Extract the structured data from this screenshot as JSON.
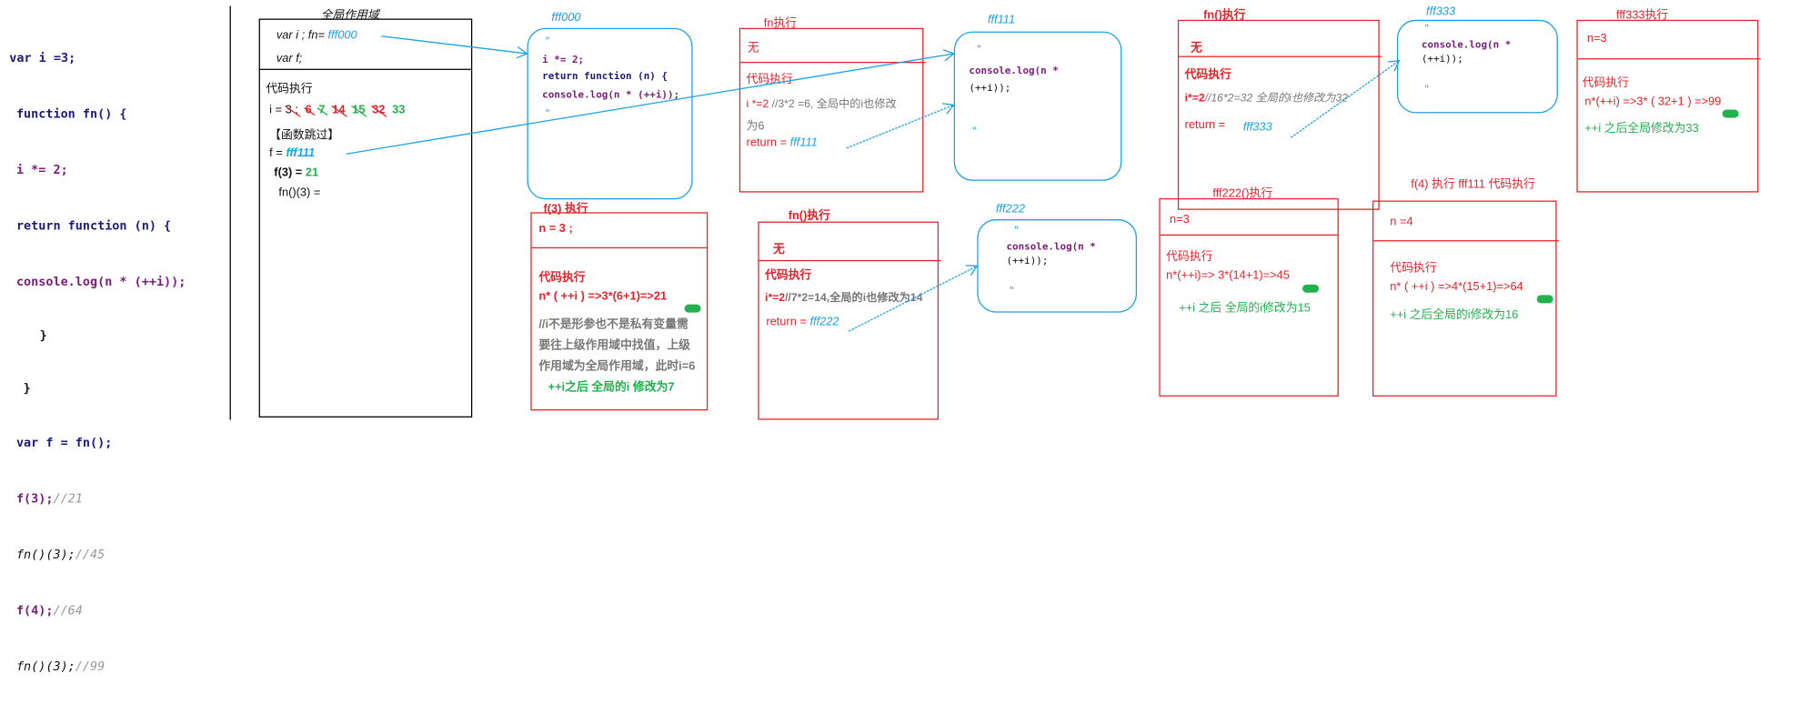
{
  "code": {
    "lines": [
      "var i =3;",
      "function fn() {",
      "i *= 2;",
      "return function (n) {",
      "console.log(n * (++i));",
      "}",
      "}",
      "var f = fn();"
    ],
    "calls": [
      {
        "call": "f(3);",
        "comment": "//21"
      },
      {
        "call": "fn()(3);",
        "comment": "//45"
      },
      {
        "call": "f(4);",
        "comment": "//64"
      },
      {
        "call": "fn()(3);",
        "comment": "//99"
      }
    ]
  },
  "global": {
    "title": "全局作用域",
    "var_line": "var i ; fn=",
    "fn_ref": "fff000",
    "var_f": "var f;",
    "exec_label": "代码执行",
    "i_prefix": "i =",
    "i_values": [
      {
        "v": "3 ;",
        "color": "#111111",
        "struck": true
      },
      {
        "v": "6",
        "color": "#e8222a",
        "struck": true
      },
      {
        "v": "7",
        "color": "#22b14c",
        "struck": true
      },
      {
        "v": "14",
        "color": "#e8222a",
        "struck": true
      },
      {
        "v": "15",
        "color": "#22b14c",
        "struck": true
      },
      {
        "v": "32",
        "color": "#e8222a",
        "struck": true
      },
      {
        "v": "33",
        "color": "#22b14c",
        "struck": false
      }
    ],
    "skip_label": "【函数跳过】",
    "f_assign": "f =",
    "f_ref": "fff111",
    "f3_label": "f(3) =",
    "f3_value": "21",
    "fn3_label": "fn()(3) ="
  },
  "heaps": {
    "fff000": {
      "label": "fff000",
      "lines": [
        "\"",
        "i *= 2;",
        "return function (n) {",
        "console.log(n * (++i));",
        "\""
      ]
    },
    "fff111": {
      "label": "fff111",
      "lines": [
        "\"",
        "console.log(n *",
        "(++i));",
        "\""
      ]
    },
    "fff333": {
      "label": "fff333",
      "lines": [
        "\"",
        "console.log(n *",
        "(++i));",
        "\""
      ]
    },
    "fff222": {
      "label": "fff222",
      "lines": [
        "\"",
        "console.log(n *",
        "(++i));",
        "\""
      ]
    }
  },
  "frames": {
    "fn1": {
      "title": "fn执行",
      "private": "无",
      "exec": "代码执行",
      "step": "i *=2",
      "comment": "//3*2 =6, 全局中的i也修改",
      "comment2": "为6",
      "ret": "return =",
      "ref": "fff111"
    },
    "fn2": {
      "title": "fn()执行",
      "private": "无",
      "exec": "代码执行",
      "step": "i*=2",
      "comment": "//7*2=14,全局的i也修改为14",
      "ret": "return =",
      "ref": "fff222"
    },
    "fn3": {
      "title": "fn()执行",
      "private": "无",
      "exec": "代码执行",
      "step": "i*=2",
      "comment": "//16*2=32 全局的i也修改为32",
      "ret": "return =",
      "ref": "fff333"
    },
    "f3": {
      "title": "f(3) 执行",
      "private": "n = 3 ;",
      "exec": "代码执行",
      "calc": "n* ( ++i ) =>3*(6+1)=>",
      "result": "21",
      "note": [
        "//i不是形参也不是私有变量需",
        "要往上级作用域中找值，上级",
        "作用域为全局作用域，此时i=6"
      ],
      "after": "++i之后 全局的i 修改为7"
    },
    "fff222exec": {
      "title": "fff222()执行",
      "private": "n=3",
      "exec": "代码执行",
      "calc": "n*(++i)=> 3*(14+1)=>",
      "result": "45",
      "after": "++i 之后 全局的i修改为15"
    },
    "f4": {
      "title": "f(4) 执行 fff111 代码执行",
      "private": "n =4",
      "exec": "代码执行",
      "calc": "n* ( ++i ) =>4*(15+1)=>",
      "result": "64",
      "after": "++i 之后全局的i修改为16"
    },
    "fff333exec": {
      "title": "fff333执行",
      "private": "n=3",
      "exec": "代码执行",
      "calc": "n*(++i) =>3* ( 32+1 ) =>",
      "result": "99",
      "after": "++i 之后全局修改为33"
    }
  },
  "colors": {
    "red": "#e8222a",
    "blue": "#1da1e6",
    "green": "#22b14c"
  }
}
